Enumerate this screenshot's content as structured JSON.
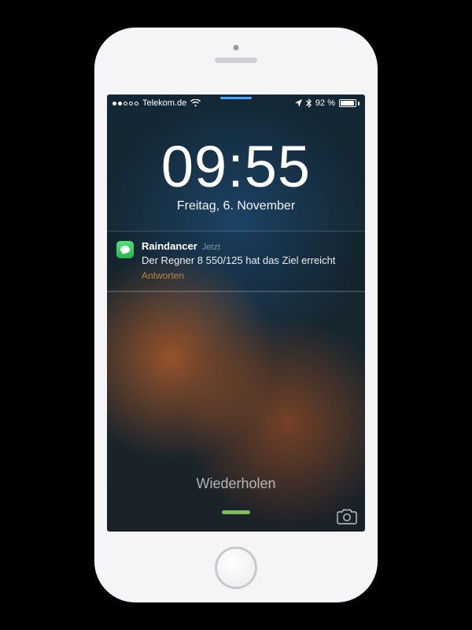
{
  "statusBar": {
    "carrier": "Telekom.de",
    "batteryPercent": "92 %"
  },
  "lockScreen": {
    "time": "09:55",
    "date": "Freitag, 6. November",
    "unlockHint": "Wiederholen"
  },
  "notification": {
    "appName": "Raindancer",
    "timeAgo": "Jetzt",
    "message": "Der Regner 8 550/125 hat das Ziel erreicht",
    "replyLabel": "Antworten"
  }
}
